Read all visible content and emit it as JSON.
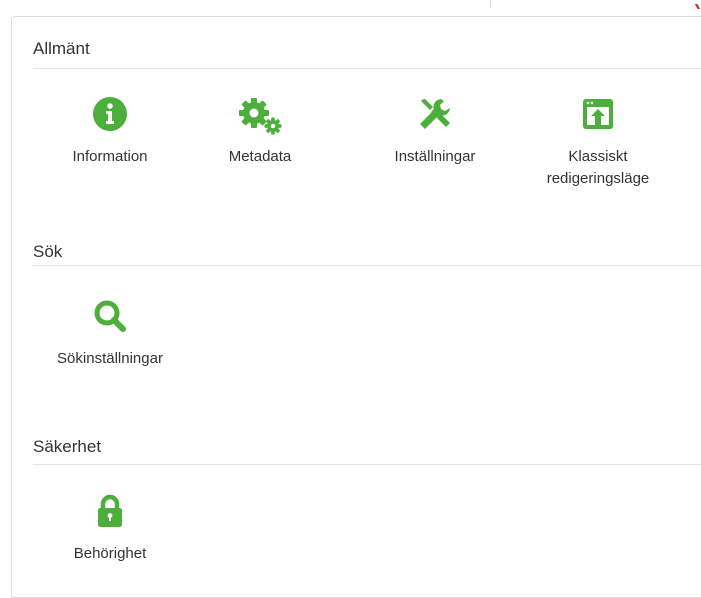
{
  "sections": [
    {
      "title": "Allmänt",
      "items": [
        {
          "label": "Information",
          "icon": "info-circle-icon"
        },
        {
          "label": "Metadata",
          "icon": "gears-icon"
        },
        {
          "label": "Inställningar",
          "icon": "tools-icon"
        },
        {
          "label": "Klassiskt redigeringsläge",
          "icon": "window-upload-icon"
        }
      ]
    },
    {
      "title": "Sök",
      "items": [
        {
          "label": "Sökinställningar",
          "icon": "search-icon"
        }
      ]
    },
    {
      "title": "Säkerhet",
      "items": [
        {
          "label": "Behörighet",
          "icon": "lock-icon"
        }
      ]
    }
  ],
  "colors": {
    "icon_green": "#4cae3b",
    "text": "#333333",
    "rule": "#e5e5e5",
    "top_accent": "#d9261c"
  }
}
